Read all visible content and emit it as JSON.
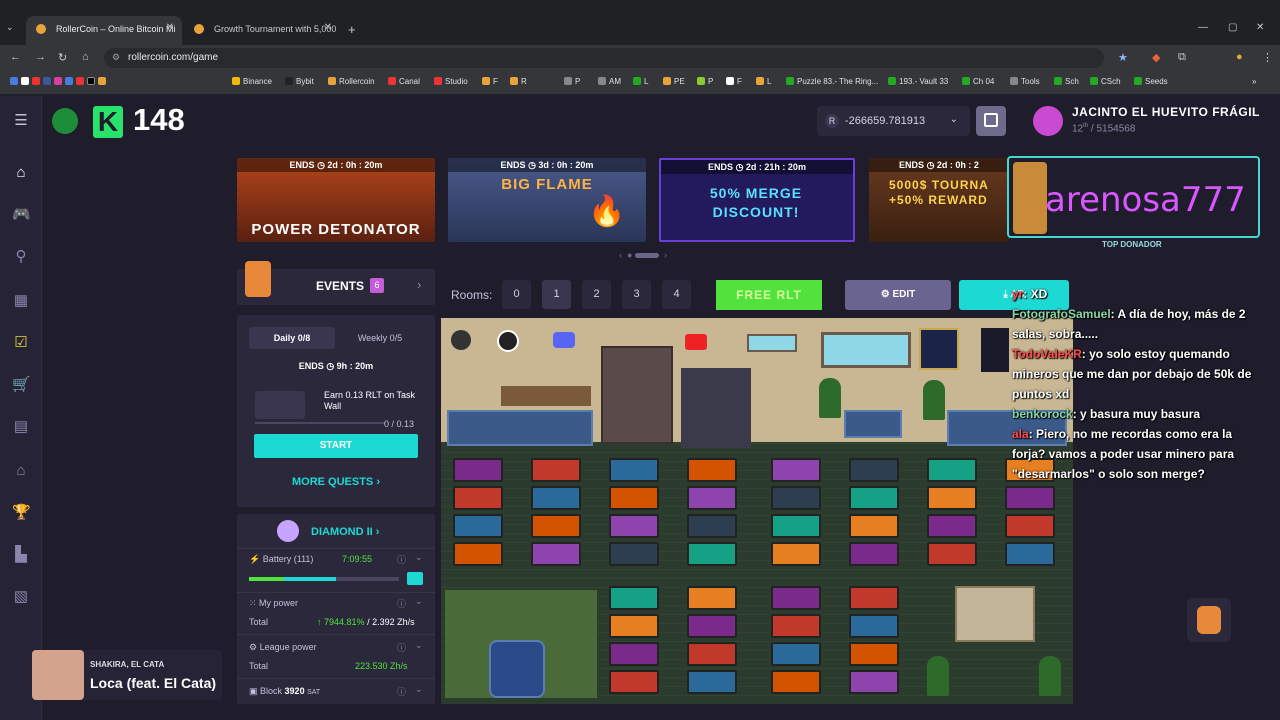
{
  "browser": {
    "tabs": [
      {
        "title": "RollerCoin – Online Bitcoin Mi"
      },
      {
        "title": "Growth Tournament with 5,000"
      }
    ],
    "url": "rollercoin.com/game",
    "bookmarks": [
      "Binance",
      "Bybit",
      "Rollercoin",
      "Canal",
      "Studio",
      "F",
      "R",
      "P",
      "AM",
      "L",
      "PE",
      "P",
      "F",
      "L",
      "Puzzle 83.- The Ring...",
      "193.- Vault 33",
      "Ch 04",
      "Tools",
      "Sch",
      "CSch",
      "Seeds"
    ]
  },
  "header": {
    "level": "148",
    "balance": "-266659.781913",
    "balance_currency_icon": "R",
    "username": "JACINTO EL HUEVITO FRÁGIL",
    "rank_prefix": "12",
    "rank_suffix": "th",
    "rank_total": "/ 5154568"
  },
  "banners": [
    {
      "ends": "ENDS",
      "time": "2d : 0h : 20m",
      "title": "POWER DETONATOR",
      "color": "#8a3515"
    },
    {
      "ends": "ENDS",
      "time": "3d : 0h : 20m",
      "title": "BIG FLAME",
      "color": "#3b4a7a"
    },
    {
      "ends": "ENDS",
      "time": "2d : 21h : 20m",
      "title": "50% MERGE DISCOUNT!",
      "color": "#2a1f6a"
    },
    {
      "ends": "ENDS",
      "time": "2d : 0h : 2",
      "title": "5000$ TOURNA +50% REWARD",
      "color": "#7a3a1a"
    }
  ],
  "events": {
    "label": "EVENTS",
    "count": "6",
    "tab_daily": "Daily 0/8",
    "tab_weekly": "Weekly 0/5",
    "ends_label": "ENDS",
    "ends_time": "9h : 20m",
    "quest_text": "Earn 0.13 RLT on Task Wall",
    "quest_progress_text": "0 / 0.13",
    "quest_progress": 0,
    "start_label": "START",
    "more_quests": "MORE QUESTS"
  },
  "league": {
    "name": "DIAMOND II",
    "battery_label": "Battery (111)",
    "battery_time": "7:09:55",
    "battery_level": 0.58,
    "my_power_label": "My power",
    "total_label": "Total",
    "my_power_bonus": "↑ 7944.81%",
    "my_power_value": "/ 2.392 Zh/s",
    "league_power_label": "League power",
    "league_total_label": "Total",
    "league_total_value": "223.530 Zh/s",
    "block_label": "Block",
    "block_value": "3920",
    "block_unit": "SAT"
  },
  "rooms": {
    "label": "Rooms:",
    "numbers": [
      "0",
      "1",
      "2",
      "3",
      "4"
    ],
    "selected": "1",
    "free_rlt": "FREE RLT",
    "edit": "EDIT",
    "about": "AB"
  },
  "donor": {
    "name": "arenosa777",
    "label": "TOP DONADOR"
  },
  "chat": [
    {
      "user": "yr",
      "text": ": XD"
    },
    {
      "user": "FotografoSamuel",
      "text": ": A día de hoy, más de 2 salas, sobra....."
    },
    {
      "user": "TodoValeKR",
      "text": ": yo solo estoy quemando mineros que me dan por debajo de 50k de puntos xd"
    },
    {
      "user": "benkorock",
      "text": ": y basura muy basura"
    },
    {
      "user": "ala",
      "text": ": Piero, no me recordas como era la forja? vamos a poder usar minero para \"desarmarlos\" o solo son merge?"
    }
  ],
  "music": {
    "artist": "SHAKIRA, EL CATA",
    "song": "Loca (feat. El Cata)"
  }
}
